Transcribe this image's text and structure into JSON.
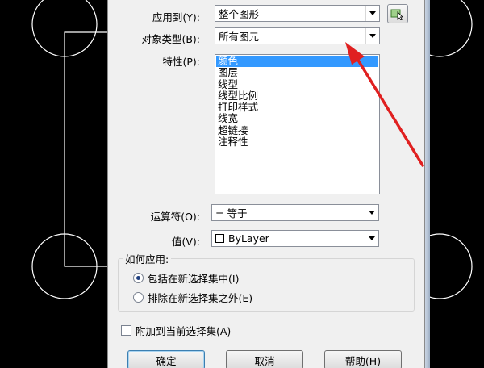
{
  "dialog": {
    "apply_to": {
      "label": "应用到(Y):",
      "value": "整个图形"
    },
    "object_type": {
      "label": "对象类型(B):",
      "value": "所有图元"
    },
    "properties": {
      "label": "特性(P):",
      "items": [
        "颜色",
        "图层",
        "线型",
        "线型比例",
        "打印样式",
        "线宽",
        "超链接",
        "注释性"
      ],
      "selected_index": 0
    },
    "operator": {
      "label": "运算符(O):",
      "value": "= 等于"
    },
    "value": {
      "label": "值(V):",
      "value": "ByLayer"
    },
    "how_to_apply": {
      "title": "如何应用:",
      "options": [
        {
          "label": "包括在新选择集中(I)",
          "selected": true
        },
        {
          "label": "排除在新选择集之外(E)",
          "selected": false
        }
      ]
    },
    "append": {
      "label": "附加到当前选择集(A)",
      "checked": false
    },
    "buttons": {
      "ok": "确定",
      "cancel": "取消",
      "help": "帮助(H)"
    }
  },
  "colors": {
    "cad_background": "#000000",
    "cad_lines": "#ffffff",
    "annotation_arrow": "#e02020",
    "selection": "#3399ff"
  },
  "icons": {
    "select_objects": "select-objects-icon"
  }
}
